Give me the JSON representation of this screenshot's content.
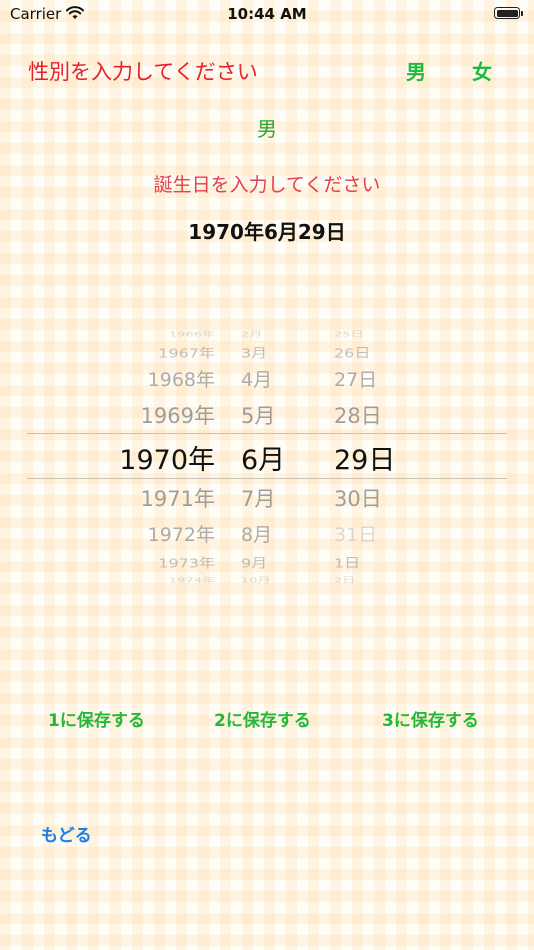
{
  "status_bar": {
    "carrier": "Carrier",
    "time": "10:44 AM"
  },
  "gender": {
    "prompt": "性別を入力してください",
    "male_label": "男",
    "female_label": "女",
    "selected": "男"
  },
  "birthday": {
    "prompt": "誕生日を入力してください",
    "selected_date": "1970年6月29日"
  },
  "picker": {
    "years": [
      "1966年",
      "1967年",
      "1968年",
      "1969年",
      "1970年",
      "1971年",
      "1972年",
      "1973年",
      "1974年"
    ],
    "months": [
      "2月",
      "3月",
      "4月",
      "5月",
      "6月",
      "7月",
      "8月",
      "9月",
      "10月"
    ],
    "days": [
      "25日",
      "26日",
      "27日",
      "28日",
      "29日",
      "30日",
      "31日",
      "1日",
      "2日"
    ],
    "selected_year": "1970年",
    "selected_month": "6月",
    "selected_day": "29日"
  },
  "save_buttons": {
    "slot1": "1に保存する",
    "slot2": "2に保存する",
    "slot3": "3に保存する"
  },
  "back_label": "もどる",
  "colors": {
    "prompt_red": "#e8202a",
    "button_green": "#22b83a",
    "link_blue": "#1a7fe8"
  }
}
